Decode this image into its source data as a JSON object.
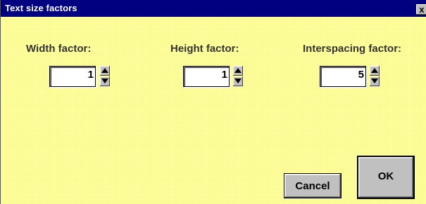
{
  "dialog": {
    "title": "Text size factors",
    "close_glyph": "x",
    "background_color": "#ffff99",
    "titlebar_color": "#000080"
  },
  "fields": [
    {
      "label": "Width factor:",
      "value": "1"
    },
    {
      "label": "Height factor:",
      "value": "1"
    },
    {
      "label": "Interspacing factor:",
      "value": "5"
    }
  ],
  "buttons": {
    "cancel_label": "Cancel",
    "ok_label": "OK"
  },
  "icons": {
    "spin_up": "arrow-up-icon",
    "spin_down": "arrow-down-icon",
    "close": "close-icon"
  }
}
